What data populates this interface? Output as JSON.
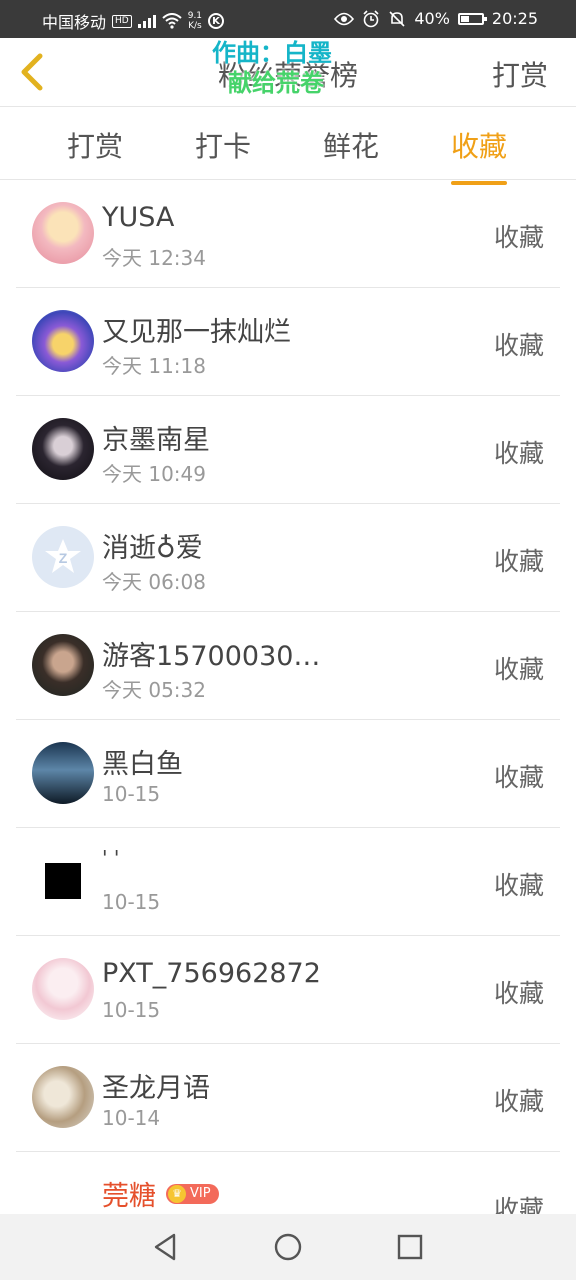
{
  "status_bar": {
    "carrier": "中国移动",
    "hd": "HD",
    "network": "4G",
    "speed_value": "9.1",
    "speed_unit": "K/s",
    "battery": "40%",
    "battery_level": 0.4,
    "time": "20:25"
  },
  "header": {
    "title": "粉丝荣誉榜",
    "action": "打赏",
    "lyrics_line1": "作曲：白墨",
    "lyrics_line2": "献给荒卷"
  },
  "tabs": [
    {
      "label": "打赏"
    },
    {
      "label": "打卡"
    },
    {
      "label": "鲜花"
    },
    {
      "label": "收藏",
      "active": true
    }
  ],
  "list": [
    {
      "name": "YUSA",
      "time": "今天 12:34",
      "action": "收藏"
    },
    {
      "name": "又见那一抹灿烂",
      "time": "今天 11:18",
      "action": "收藏"
    },
    {
      "name": "京墨南星",
      "time": "今天 10:49",
      "action": "收藏"
    },
    {
      "name": "消逝♁爱",
      "time": "今天 06:08",
      "action": "收藏"
    },
    {
      "name": "游客15700030…",
      "time": "今天 05:32",
      "action": "收藏"
    },
    {
      "name": "黑白鱼",
      "time": "10-15",
      "action": "收藏"
    },
    {
      "name": "' '",
      "time": "10-15",
      "action": "收藏"
    },
    {
      "name": "PXT_756962872",
      "time": "10-15",
      "action": "收藏"
    },
    {
      "name": "圣龙月语",
      "time": "10-14",
      "action": "收藏"
    },
    {
      "name": "莞糖",
      "time": "",
      "action": "收藏",
      "vip": "VIP"
    }
  ],
  "colors": {
    "accent": "#f0a017",
    "vip_name": "#e5502c"
  },
  "icons": {
    "back": "chevron-left-icon",
    "nav_back": "triangle-back-icon",
    "nav_home": "circle-home-icon",
    "nav_recent": "square-recent-icon"
  }
}
